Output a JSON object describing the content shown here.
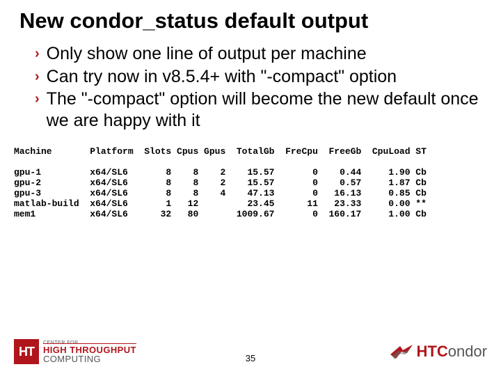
{
  "title": "New condor_status default output",
  "bullets": [
    "Only show one line of output per machine",
    "Can try now in v8.5.4+ with \"-compact\" option",
    "The \"-compact\" option will become the new default once we are happy with it"
  ],
  "table": {
    "headers": [
      "Machine",
      "Platform",
      "Slots",
      "Cpus",
      "Gpus",
      "TotalGb",
      "FreCpu",
      "FreeGb",
      "CpuLoad",
      "ST"
    ],
    "rows": [
      [
        "gpu-1",
        "x64/SL6",
        "8",
        "8",
        "2",
        "15.57",
        "0",
        "0.44",
        "1.90",
        "Cb"
      ],
      [
        "gpu-2",
        "x64/SL6",
        "8",
        "8",
        "2",
        "15.57",
        "0",
        "0.57",
        "1.87",
        "Cb"
      ],
      [
        "gpu-3",
        "x64/SL6",
        "8",
        "8",
        "4",
        "47.13",
        "0",
        "16.13",
        "0.85",
        "Cb"
      ],
      [
        "matlab-build",
        "x64/SL6",
        "1",
        "12",
        "",
        "23.45",
        "11",
        "23.33",
        "0.00",
        "**"
      ],
      [
        "mem1",
        "x64/SL6",
        "32",
        "80",
        "",
        "1009.67",
        "0",
        "160.17",
        "1.00",
        "Cb"
      ]
    ]
  },
  "footer": {
    "left_badge": "HT",
    "left_line1": "CENTER FOR",
    "left_line2": "HIGH THROUGHPUT",
    "left_line3": "COMPUTING",
    "right_prefix": "HTC",
    "right_suffix": "ondor",
    "page": "35"
  },
  "chart_data": {
    "type": "table",
    "title": "condor_status -compact sample output",
    "columns": [
      "Machine",
      "Platform",
      "Slots",
      "Cpus",
      "Gpus",
      "TotalGb",
      "FreCpu",
      "FreeGb",
      "CpuLoad",
      "ST"
    ],
    "rows": [
      {
        "Machine": "gpu-1",
        "Platform": "x64/SL6",
        "Slots": 8,
        "Cpus": 8,
        "Gpus": 2,
        "TotalGb": 15.57,
        "FreCpu": 0,
        "FreeGb": 0.44,
        "CpuLoad": 1.9,
        "ST": "Cb"
      },
      {
        "Machine": "gpu-2",
        "Platform": "x64/SL6",
        "Slots": 8,
        "Cpus": 8,
        "Gpus": 2,
        "TotalGb": 15.57,
        "FreCpu": 0,
        "FreeGb": 0.57,
        "CpuLoad": 1.87,
        "ST": "Cb"
      },
      {
        "Machine": "gpu-3",
        "Platform": "x64/SL6",
        "Slots": 8,
        "Cpus": 8,
        "Gpus": 4,
        "TotalGb": 47.13,
        "FreCpu": 0,
        "FreeGb": 16.13,
        "CpuLoad": 0.85,
        "ST": "Cb"
      },
      {
        "Machine": "matlab-build",
        "Platform": "x64/SL6",
        "Slots": 1,
        "Cpus": 12,
        "Gpus": null,
        "TotalGb": 23.45,
        "FreCpu": 11,
        "FreeGb": 23.33,
        "CpuLoad": 0.0,
        "ST": "**"
      },
      {
        "Machine": "mem1",
        "Platform": "x64/SL6",
        "Slots": 32,
        "Cpus": 80,
        "Gpus": null,
        "TotalGb": 1009.67,
        "FreCpu": 0,
        "FreeGb": 160.17,
        "CpuLoad": 1.0,
        "ST": "Cb"
      }
    ]
  }
}
